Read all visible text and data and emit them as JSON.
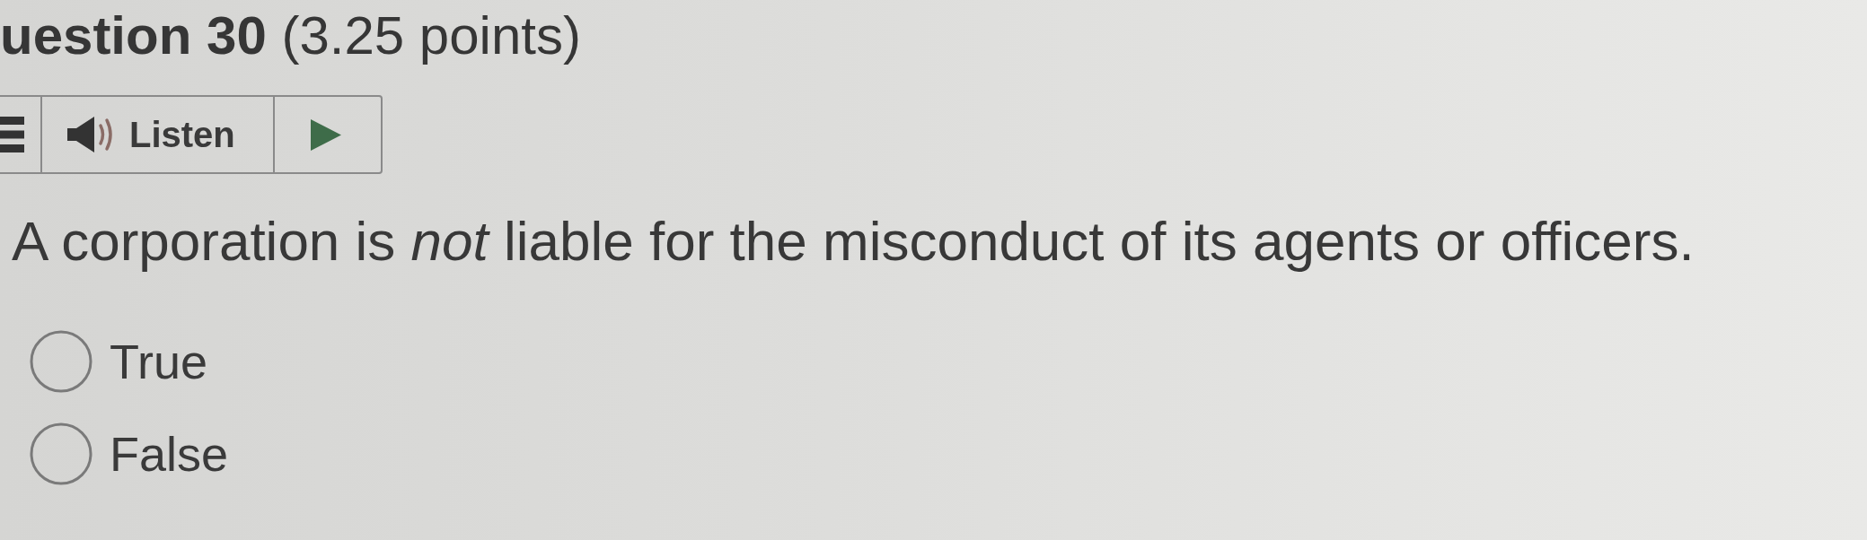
{
  "heading": "**uestion 30** (3.25 points)",
  "listen_toolbar": {
    "label": "Listen"
  },
  "question": "A corporation is *not* liable for the misconduct of its agents or officers.",
  "options": [
    {
      "label": "True",
      "selected": false
    },
    {
      "label": "False",
      "selected": false
    }
  ]
}
